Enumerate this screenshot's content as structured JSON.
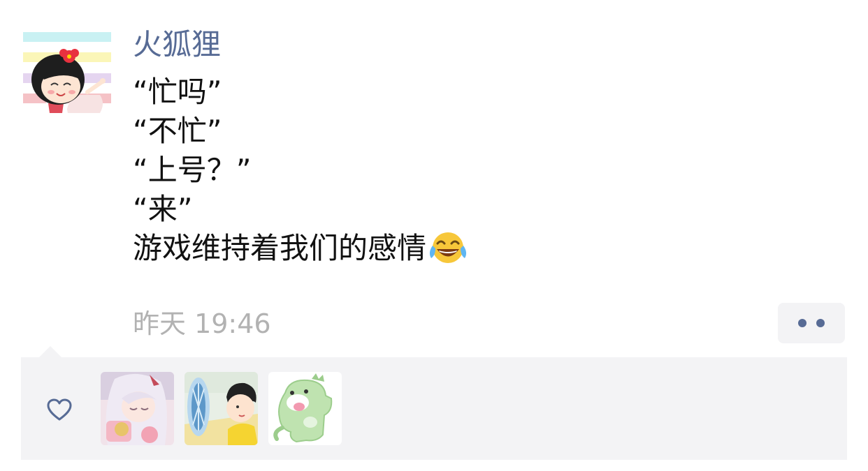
{
  "post": {
    "author": "火狐狸",
    "lines": [
      "“忙吗”",
      "“不忙”",
      "“上号？”",
      "“来”",
      "游戏维持着我们的感情"
    ],
    "emoji": "face-with-tears-of-joy",
    "time": "昨天 19:46"
  },
  "likes": {
    "icon": "heart-icon",
    "avatars": [
      "liker-avatar-anime-girl",
      "liker-avatar-boy-with-fan",
      "liker-avatar-green-dinosaur"
    ]
  },
  "colors": {
    "author": "#576b95",
    "time": "#b2b2b2",
    "panel": "#f3f3f5",
    "text": "#111111"
  }
}
